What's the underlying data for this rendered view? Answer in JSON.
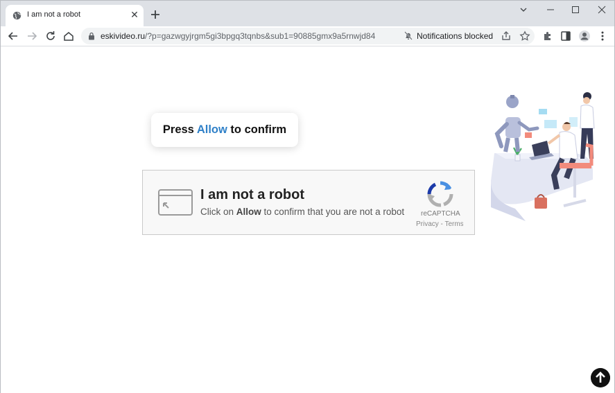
{
  "browser": {
    "tab": {
      "title": "I am not a robot",
      "favicon": "globe-icon",
      "close_icon": "close-icon"
    },
    "new_tab_icon": "plus-icon",
    "window_controls": [
      "chevron-down-icon",
      "minimize-icon",
      "maximize-icon",
      "close-icon"
    ],
    "nav": [
      "back-arrow-icon",
      "forward-arrow-icon",
      "reload-icon",
      "home-icon"
    ],
    "address": {
      "host": "eskivideo.ru",
      "path": "/?p=gazwgyjrgm5gi3bpgq3tqnbs&sub1=90885gmx9a5rnwjd84",
      "lock_icon": "lock-icon"
    },
    "notifications": {
      "icon": "bell-slash-icon",
      "label": "Notifications blocked"
    },
    "omnibox_icons": [
      "share-icon",
      "star-icon"
    ],
    "toolbar_icons": [
      "puzzle-icon",
      "side-panel-icon",
      "profile-icon",
      "kebab-menu-icon"
    ]
  },
  "page": {
    "press_prompt": {
      "before": "Press ",
      "highlight": "Allow",
      "after": " to confirm"
    },
    "captcha": {
      "title": "I am not a robot",
      "sub_before": "Click on ",
      "sub_bold": "Allow",
      "sub_after": " to confirm that you are not a robot",
      "brand": "reCAPTCHA",
      "links": "Privacy - Terms"
    },
    "scroll_top_icon": "arrow-up-icon"
  },
  "colors": {
    "accent": "#2f80c8",
    "tabstrip": "#dee1e6",
    "omnibox": "#f1f3f4"
  }
}
